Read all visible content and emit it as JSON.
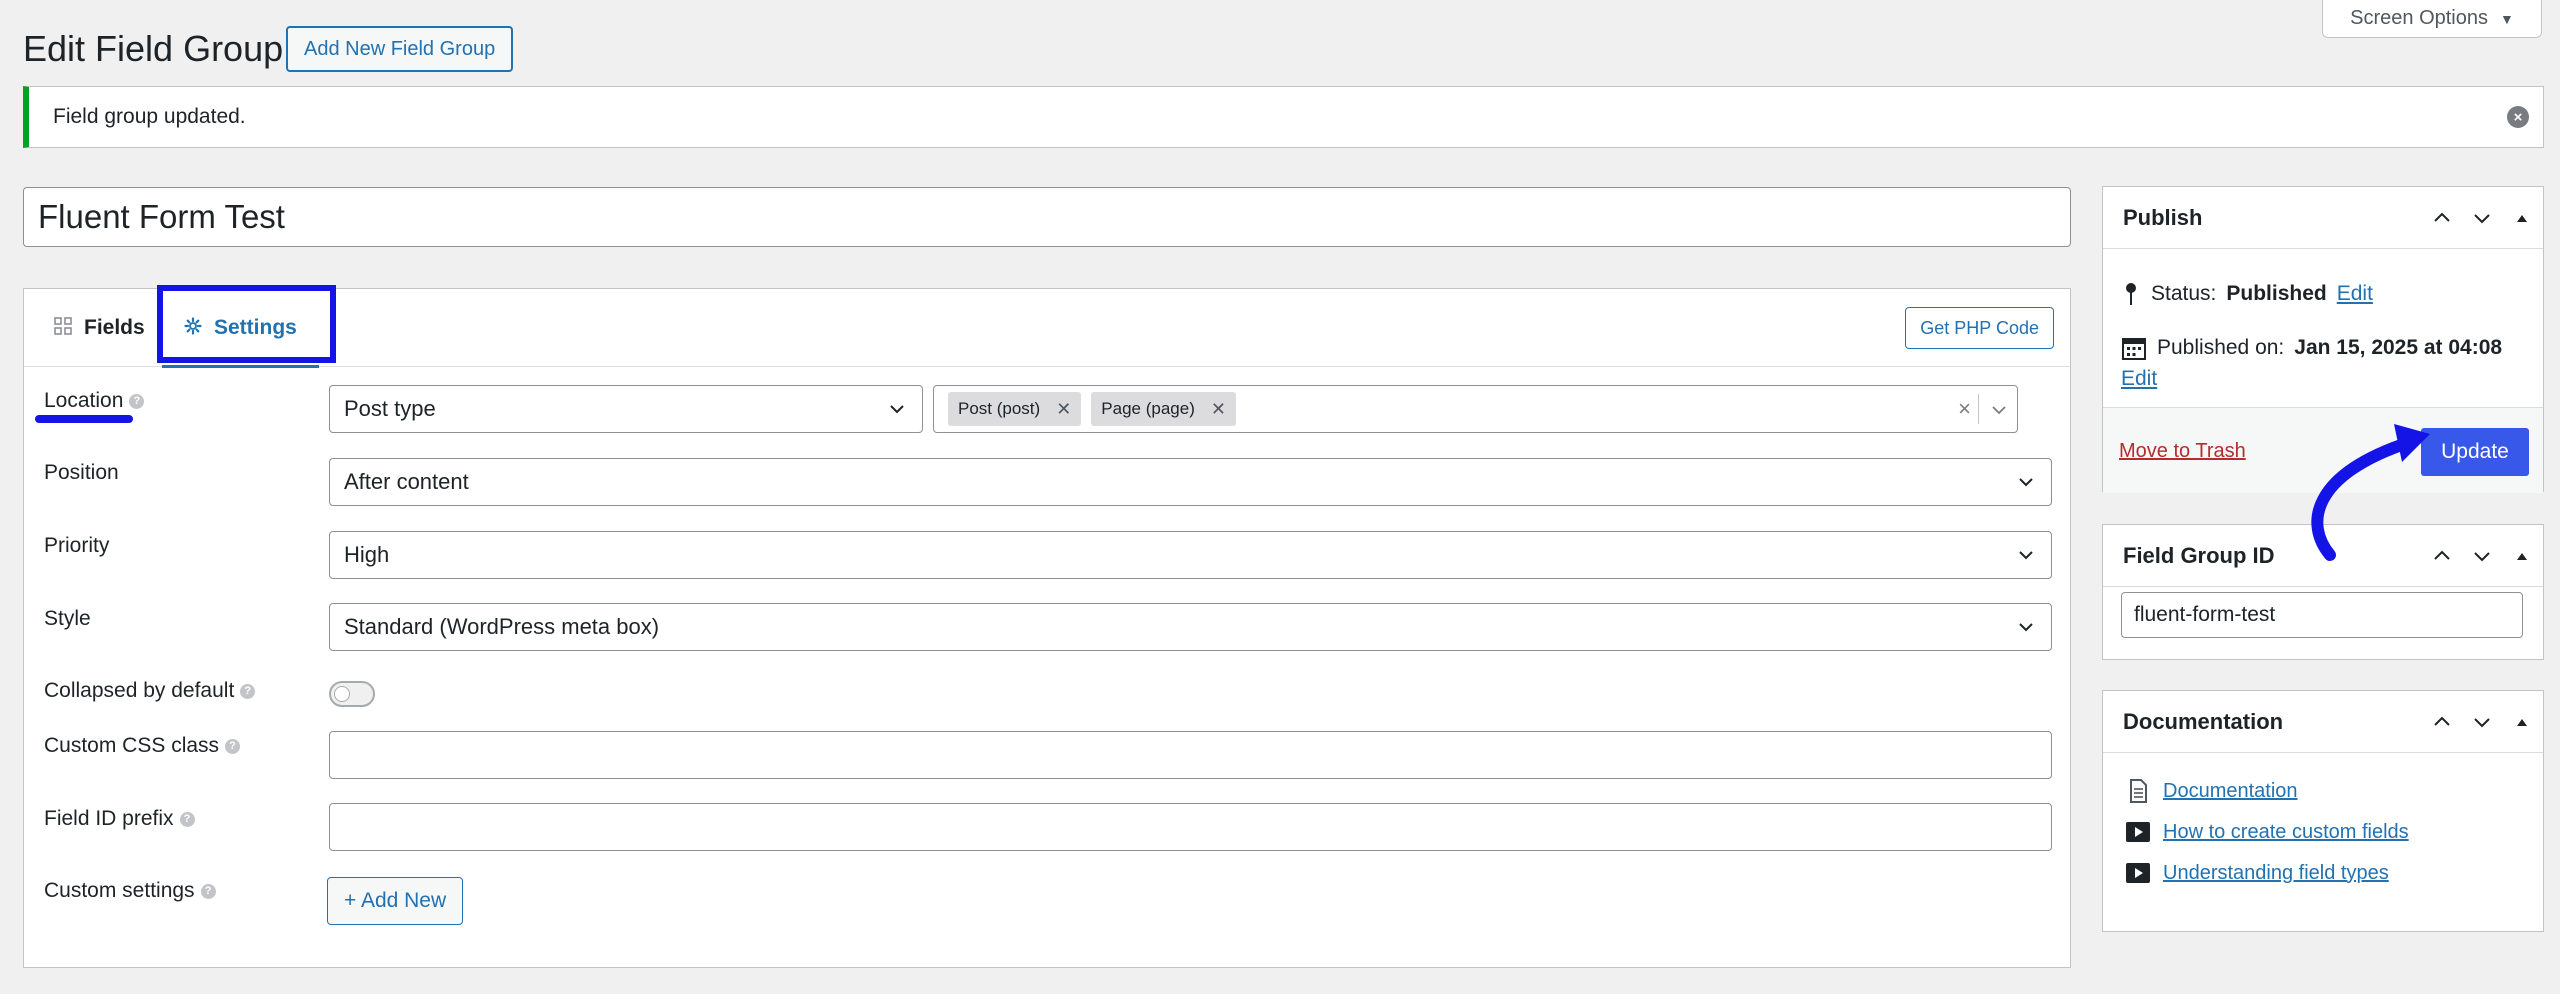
{
  "screen_options": {
    "label": "Screen Options",
    "arrow": "▼"
  },
  "header": {
    "title": "Edit Field Group",
    "add_new": "Add New Field Group"
  },
  "notice": {
    "text": "Field group updated."
  },
  "field_group_title": "Fluent Form Test",
  "tabs": {
    "fields": "Fields",
    "settings": "Settings",
    "get_php": "Get PHP Code"
  },
  "settings": {
    "location": {
      "label": "Location",
      "select": "Post type",
      "chips": [
        "Post (post)",
        "Page (page)"
      ]
    },
    "position": {
      "label": "Position",
      "value": "After content"
    },
    "priority": {
      "label": "Priority",
      "value": "High"
    },
    "style": {
      "label": "Style",
      "value": "Standard (WordPress meta box)"
    },
    "collapsed": {
      "label": "Collapsed by default"
    },
    "css_class": {
      "label": "Custom CSS class"
    },
    "id_prefix": {
      "label": "Field ID prefix"
    },
    "custom_settings": {
      "label": "Custom settings",
      "button": "+ Add New"
    }
  },
  "publish": {
    "title": "Publish",
    "status_label": "Status:",
    "status_value": "Published",
    "edit": "Edit",
    "published_label": "Published on:",
    "published_value": "Jan 15, 2025 at 04:08",
    "trash": "Move to Trash",
    "update": "Update"
  },
  "field_group_id": {
    "title": "Field Group ID",
    "value": "fluent-form-test"
  },
  "documentation": {
    "title": "Documentation",
    "links": [
      "Documentation",
      "How to create custom fields",
      "Understanding field types"
    ]
  },
  "colors": {
    "accent": "#2271b1",
    "annotation": "#1414e6",
    "success": "#00a32a",
    "danger": "#b32d2e"
  }
}
